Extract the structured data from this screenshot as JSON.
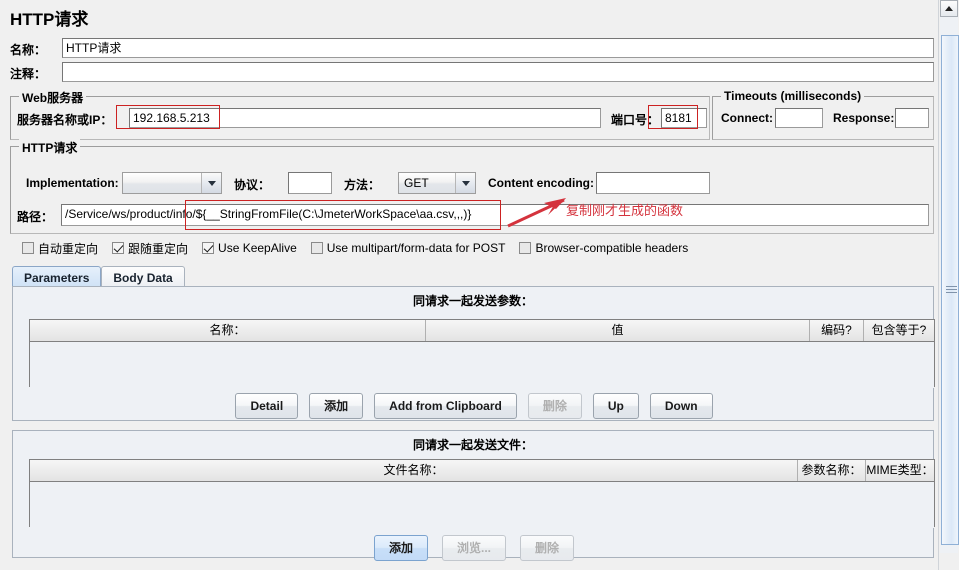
{
  "page_title": "HTTP请求",
  "name_row": {
    "label": "名称：",
    "value": "HTTP请求"
  },
  "comment_row": {
    "label": "注释：",
    "value": ""
  },
  "web_server": {
    "panel_title": "Web服务器",
    "server_label": "服务器名称或IP：",
    "server_value": "192.168.5.213",
    "port_label": "端口号：",
    "port_value": "8181"
  },
  "timeouts": {
    "panel_title": "Timeouts (milliseconds)",
    "connect_label": "Connect:",
    "connect_value": "",
    "response_label": "Response:",
    "response_value": ""
  },
  "http_request": {
    "panel_title": "HTTP请求",
    "implementation_label": "Implementation:",
    "implementation_value": "",
    "protocol_label": "协议：",
    "protocol_value": "",
    "method_label": "方法：",
    "method_value": "GET",
    "content_encoding_label": "Content encoding:",
    "content_encoding_value": "",
    "path_label": "路径：",
    "path_value": "/Service/ws/product/info/${__StringFromFile(C:\\JmeterWorkSpace\\aa.csv,,,)}"
  },
  "checkboxes": [
    {
      "label": "自动重定向",
      "checked": false
    },
    {
      "label": "跟随重定向",
      "checked": true
    },
    {
      "label": "Use KeepAlive",
      "checked": true
    },
    {
      "label": "Use multipart/form-data for POST",
      "checked": false
    },
    {
      "label": "Browser-compatible headers",
      "checked": false
    }
  ],
  "tabs": [
    {
      "label": "Parameters",
      "active": true
    },
    {
      "label": "Body Data",
      "active": false
    }
  ],
  "parameters": {
    "caption": "同请求一起发送参数：",
    "columns": [
      "名称：",
      "值",
      "编码?",
      "包含等于?"
    ],
    "rows": [],
    "buttons": [
      {
        "label": "Detail",
        "disabled": false,
        "focused": false
      },
      {
        "label": "添加",
        "disabled": false,
        "focused": false
      },
      {
        "label": "Add from Clipboard",
        "disabled": false,
        "focused": false
      },
      {
        "label": "删除",
        "disabled": true,
        "focused": false
      },
      {
        "label": "Up",
        "disabled": false,
        "focused": false
      },
      {
        "label": "Down",
        "disabled": false,
        "focused": false
      }
    ]
  },
  "files": {
    "caption": "同请求一起发送文件：",
    "columns": [
      "文件名称：",
      "参数名称：",
      "MIME类型："
    ],
    "rows": [],
    "buttons": [
      {
        "label": "添加",
        "disabled": false,
        "focused": true
      },
      {
        "label": "浏览...",
        "disabled": true,
        "focused": false
      },
      {
        "label": "删除",
        "disabled": true,
        "focused": false
      }
    ]
  },
  "annotation": {
    "text": "复制刚才生成的函数",
    "color": "#d4333d"
  },
  "highlight_color": "#cc2222"
}
